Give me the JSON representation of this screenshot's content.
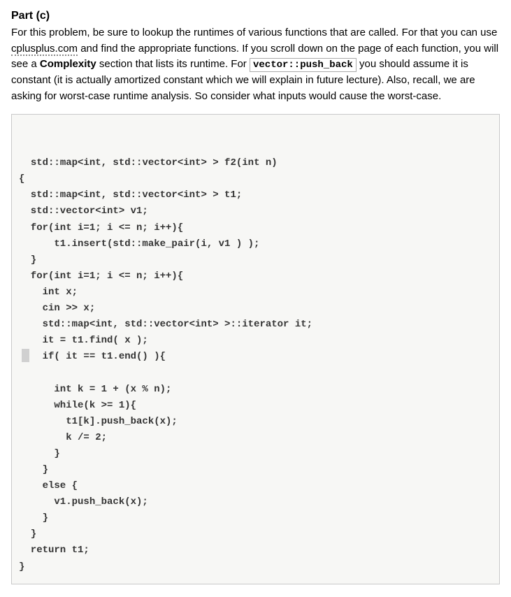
{
  "heading": "Part (c)",
  "intro": {
    "seg1": "For this problem, be sure to lookup the runtimes of various functions that are called. For that you can use ",
    "link": "cplusplus.com",
    "seg2": " and find the appropriate functions. If you scroll down on the page of each function, you will see a ",
    "bold1": "Complexity",
    "seg3": " section that lists its runtime. For ",
    "code_inline": "vector::push_back",
    "seg4": " you should assume it is constant (it is actually amortized constant which we will explain in future lecture). Also, recall, we are asking for worst-case runtime analysis. So consider what inputs would cause the worst-case."
  },
  "code": "std::map<int, std::vector<int> > f2(int n)\n{\n  std::map<int, std::vector<int> > t1;\n  std::vector<int> v1;\n  for(int i=1; i <= n; i++){\n      t1.insert(std::make_pair(i, v1 ) );\n  }\n  for(int i=1; i <= n; i++){\n    int x;\n    cin >> x;\n    std::map<int, std::vector<int> >::iterator it;\n    it = t1.find( x );\n    if( it == t1.end() ){\n\n      int k = 1 + (x % n);\n      while(k >= 1){\n        t1[k].push_back(x);\n        k /= 2;\n      }\n    }\n    else {\n      v1.push_back(x);\n    }\n  }\n  return t1;\n}"
}
